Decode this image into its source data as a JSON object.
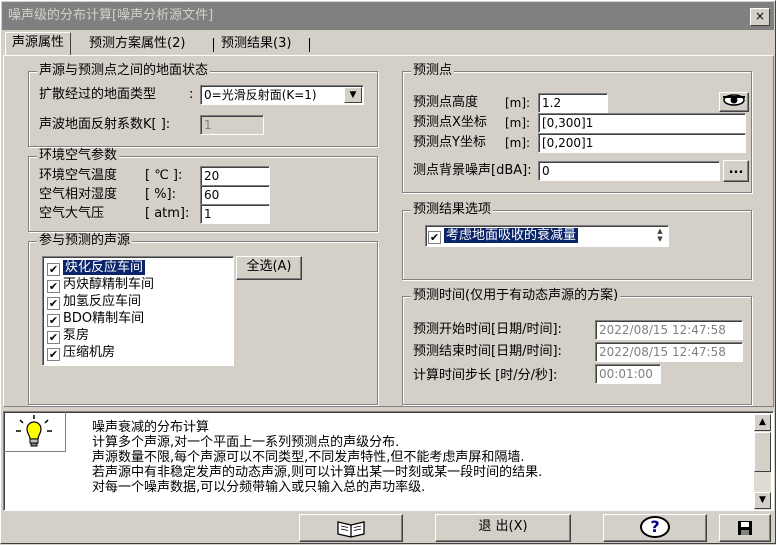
{
  "window": {
    "title": "噪声级的分布计算[噪声分析源文件]",
    "close": "×"
  },
  "tabs": [
    "声源属性",
    "预测方案属性(2)",
    "预测结果(3)"
  ],
  "ground": {
    "title": "声源与预测点之间的地面状态",
    "type_label": "扩散经过的地面类型",
    "type_sep": ":",
    "type_value": "0=光滑反射面(K=1)",
    "coef_label": "声波地面反射系数K[ ]:",
    "coef_value": "1"
  },
  "env": {
    "title": "环境空气参数",
    "temp_label": "环境空气温度",
    "temp_unit": "[ ℃ ]:",
    "temp_value": "20",
    "hum_label": "空气相对湿度",
    "hum_unit": "[ %]:",
    "hum_value": "60",
    "press_label": "空气大气压",
    "press_unit": "[ atm]:",
    "press_value": "1"
  },
  "sources": {
    "title": "参与预测的声源",
    "select_all": "全选(A)",
    "items": [
      {
        "label": "炔化反应车间",
        "checked": true
      },
      {
        "label": "丙炔醇精制车间",
        "checked": true
      },
      {
        "label": "加氢反应车间",
        "checked": true
      },
      {
        "label": "BDO精制车间",
        "checked": true
      },
      {
        "label": "泵房",
        "checked": true
      },
      {
        "label": "压缩机房",
        "checked": true
      }
    ]
  },
  "point": {
    "title": "预测点",
    "height_label": "预测点高度",
    "height_unit": "[m]:",
    "height_value": "1.2",
    "x_label": "预测点X坐标",
    "x_unit": "[m]:",
    "x_value": "[0,300]1",
    "y_label": "预测点Y坐标",
    "y_unit": "[m]:",
    "y_value": "[0,200]1",
    "bg_label": "测点背景噪声[dBA]:",
    "bg_value": "0",
    "browse": "..."
  },
  "result_opts": {
    "title": "预测结果选项",
    "item": "考虑地面吸收的衰减量"
  },
  "time": {
    "title": "预测时间(仅用于有动态声源的方案)",
    "start_label": "预测开始时间[日期/时间]:",
    "start_value": "2022/08/15 12:47:58",
    "end_label": "预测结束时间[日期/时间]:",
    "end_value": "2022/08/15 12:47:58",
    "step_label": "计算时间步长 [时/分/秒]:",
    "step_value": "00:01:00"
  },
  "help": {
    "lines": [
      "噪声衰减的分布计算",
      "计算多个声源,对一个平面上一系列预测点的声级分布.",
      "声源数量不限,每个声源可以不同类型,不同发声特性,但不能考虑声屏和隔墙.",
      "若声源中有非稳定发声的动态声源,则可以计算出某一时刻或某一段时间的结果.",
      "对每一个噪声数据,可以分频带输入或只输入总的声功率级."
    ]
  },
  "footer": {
    "exit": "退 出(X)",
    "help_glyph": "?"
  }
}
